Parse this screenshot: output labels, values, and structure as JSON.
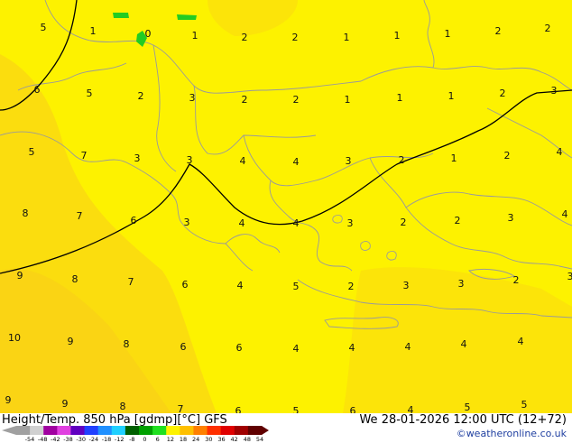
{
  "map": {
    "background": "#fdf200",
    "warm_shade": "#f9cc1a",
    "land_border_color": "#9a9a9a",
    "contour_color": "#000000",
    "green_patches_color": "#22cc22",
    "labels": [
      "5",
      "1",
      "0",
      "1",
      "2",
      "2",
      "1",
      "1",
      "1",
      "2",
      "2",
      "6",
      "5",
      "2",
      "3",
      "2",
      "2",
      "1",
      "1",
      "1",
      "2",
      "3",
      "5",
      "7",
      "3",
      "3",
      "4",
      "4",
      "3",
      "2",
      "1",
      "2",
      "4",
      "8",
      "7",
      "6",
      "3",
      "4",
      "4",
      "3",
      "2",
      "2",
      "3",
      "4",
      "9",
      "8",
      "7",
      "6",
      "4",
      "5",
      "2",
      "3",
      "3",
      "2",
      "3",
      "10",
      "9",
      "8",
      "6",
      "6",
      "4",
      "4",
      "4",
      "4",
      "4",
      "9",
      "9",
      "8",
      "7",
      "6",
      "5",
      "6",
      "4",
      "5",
      "5"
    ]
  },
  "footer": {
    "title": "Height/Temp. 850 hPa [gdmp][°C] GFS",
    "valid": "We 28-01-2026 12:00 UTC (12+72)",
    "site": "©weatheronline.co.uk"
  },
  "colorbar": {
    "ticks": [
      "-54",
      "-48",
      "-42",
      "-38",
      "-30",
      "-24",
      "-18",
      "-12",
      "-8",
      "0",
      "6",
      "12",
      "18",
      "24",
      "30",
      "36",
      "42",
      "48",
      "54"
    ],
    "colors": [
      "#a0a0a0",
      "#d0d0d0",
      "#a000a0",
      "#e040e0",
      "#6000c0",
      "#2040ff",
      "#2090ff",
      "#20d0ff",
      "#006000",
      "#00a000",
      "#20e020",
      "#fdf200",
      "#ffc000",
      "#ff8000",
      "#ff3000",
      "#e00000",
      "#a00000",
      "#600000"
    ]
  }
}
